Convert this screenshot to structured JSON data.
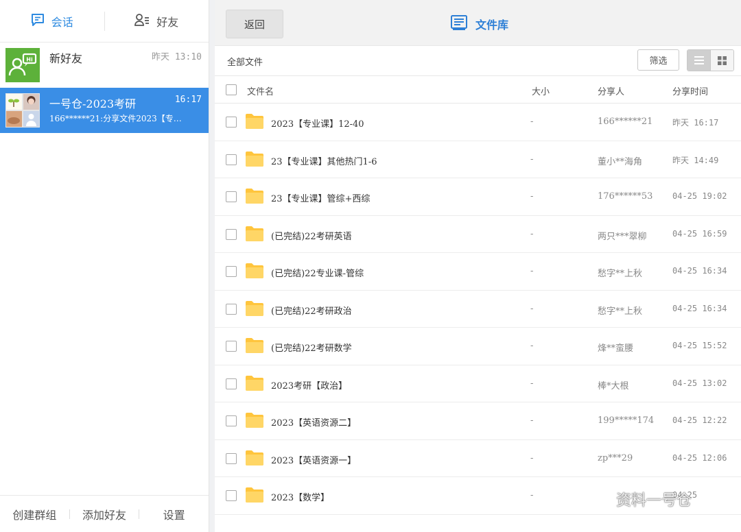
{
  "left": {
    "tabs": [
      {
        "label": "会话",
        "icon": "chat-icon",
        "active": true
      },
      {
        "label": "好友",
        "icon": "contacts-icon",
        "active": false
      }
    ],
    "conversations": [
      {
        "name": "新好友",
        "time": "昨天 13:10",
        "preview": ""
      },
      {
        "name": "一号仓-2023考研",
        "time": "16:17",
        "preview": "166******21:分享文件2023【专…",
        "selected": true
      }
    ],
    "footer": {
      "create_group": "创建群组",
      "add_friend": "添加好友",
      "settings": "设置"
    }
  },
  "header": {
    "back_label": "返回",
    "title": "文件库",
    "title_icon": "file-library-icon"
  },
  "toolbar": {
    "all_files": "全部文件",
    "filter_label": "筛选",
    "view_modes": [
      "list-view-icon",
      "grid-view-icon"
    ],
    "active_view": "list"
  },
  "table": {
    "columns": {
      "name": "文件名",
      "size": "大小",
      "sharer": "分享人",
      "time": "分享时间"
    },
    "rows": [
      {
        "name": "2023【专业课】12-40",
        "size": "-",
        "sharer": "166******21",
        "time": "昨天 16:17"
      },
      {
        "name": "23【专业课】其他热门1-6",
        "size": "-",
        "sharer": "董小**海角",
        "time": "昨天 14:49"
      },
      {
        "name": "23【专业课】管综+西综",
        "size": "-",
        "sharer": "176******53",
        "time": "04-25 19:02"
      },
      {
        "name": "(已完结)22考研英语",
        "size": "-",
        "sharer": "两只***翠柳",
        "time": "04-25 16:59"
      },
      {
        "name": "(已完结)22专业课-管综",
        "size": "-",
        "sharer": "愁字**上秋",
        "time": "04-25 16:34"
      },
      {
        "name": "(已完结)22考研政治",
        "size": "-",
        "sharer": "愁字**上秋",
        "time": "04-25 16:34"
      },
      {
        "name": "(已完结)22考研数学",
        "size": "-",
        "sharer": "烽**蛮腰",
        "time": "04-25 15:52"
      },
      {
        "name": "2023考研【政治】",
        "size": "-",
        "sharer": "棒*大根",
        "time": "04-25 13:02"
      },
      {
        "name": "2023【英语资源二】",
        "size": "-",
        "sharer": "199*****174",
        "time": "04-25 12:22"
      },
      {
        "name": "2023【英语资源一】",
        "size": "-",
        "sharer": "zp***29",
        "time": "04-25 12:06"
      },
      {
        "name": "2023【数学】",
        "size": "-",
        "sharer": "",
        "time": "04-25"
      }
    ]
  },
  "watermark": "资料一号仓",
  "colors": {
    "accent": "#3a8ee6",
    "folder": "#ffc53d",
    "new_friend_avatar": "#5db13a"
  }
}
